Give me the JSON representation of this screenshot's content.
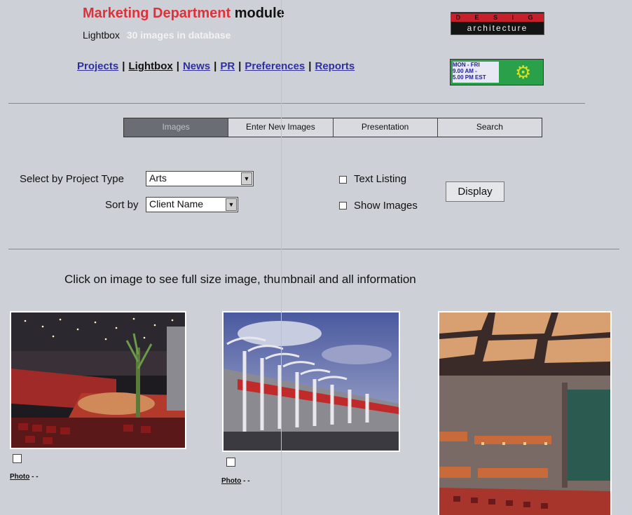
{
  "header": {
    "title_red": "Marketing Department",
    "title_black": "module",
    "subtitle": "Lightbox",
    "count_text": "30 images in database"
  },
  "nav": {
    "items": [
      "Projects",
      "Lightbox",
      "News",
      "PR",
      "Preferences",
      "Reports"
    ],
    "current": "Lightbox"
  },
  "logo": {
    "top": "D E S I G N",
    "bottom": "architecture"
  },
  "hours": {
    "line1": "MON - FRI",
    "line2": "9.00 AM -",
    "line3": "5.00 PM EST"
  },
  "tabs": [
    "Images",
    "Enter New Images",
    "Presentation",
    "Search"
  ],
  "filters": {
    "project_type_label": "Select by Project Type",
    "project_type_value": "Arts",
    "sort_label": "Sort by",
    "sort_value": "Client Name",
    "text_listing_label": "Text Listing",
    "show_images_label": "Show Images",
    "display_button": "Display"
  },
  "instruction": "Click on image to see full size image, thumbnail and all information",
  "photos": [
    {
      "label": "Photo",
      "suffix": " - -"
    },
    {
      "label": "Photo",
      "suffix": " - -"
    },
    {
      "label": "",
      "suffix": ""
    }
  ],
  "colors": {
    "title_red": "#e0303a",
    "link": "#2f2fa0",
    "background": "#cdd0d6",
    "accent_line": "#e6c25a"
  }
}
